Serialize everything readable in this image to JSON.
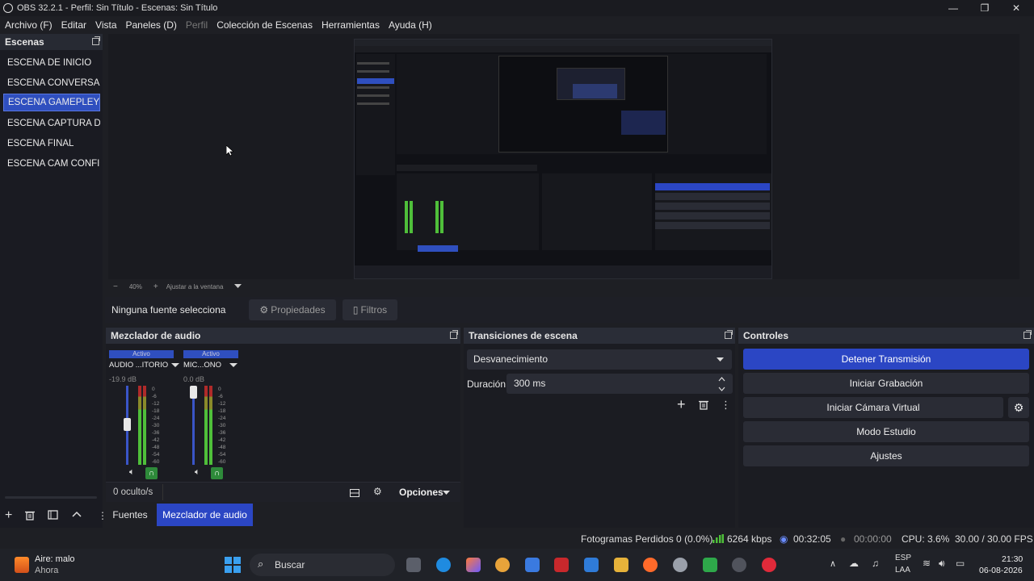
{
  "window": {
    "title": "OBS 32.2.1 - Perfil: Sin Título - Escenas: Sin Título",
    "minimize": "—",
    "maximize": "❐",
    "close": "✕"
  },
  "menu": [
    "Archivo (F)",
    "Editar",
    "Vista",
    "Paneles (D)",
    "Perfil",
    "Colección de Escenas",
    "Herramientas",
    "Ayuda (H)"
  ],
  "scenes": {
    "title": "Escenas",
    "items": [
      {
        "label": "ESCENA DE INICIO",
        "selected": false
      },
      {
        "label": "ESCENA CONVERSANDO",
        "selected": false
      },
      {
        "label": "ESCENA GAMEPLEY",
        "selected": true
      },
      {
        "label": "ESCENA CAPTURA DE P",
        "selected": false
      },
      {
        "label": "ESCENA FINAL",
        "selected": false
      },
      {
        "label": "ESCENA CAM CONFIGU",
        "selected": false
      }
    ]
  },
  "zoom": {
    "minus": "−",
    "value": "40%",
    "plus": "+",
    "fit": "Ajustar a la ventana"
  },
  "sources_bar": {
    "label": "Ninguna fuente selecciona",
    "properties": "Propiedades",
    "filters": "Filtros"
  },
  "audio_mixer": {
    "title": "Mezclador de audio",
    "channels": [
      {
        "tag": "Activo",
        "name": "AUDIO ...ITORIO",
        "db": "-19.9 dB",
        "volume": 0.55
      },
      {
        "tag": "Activo",
        "name": "MIC...ONO",
        "db": "0.0 dB",
        "volume": 1.0
      }
    ],
    "scale": [
      "0",
      "-6",
      "-12",
      "-18",
      "-24",
      "-30",
      "-36",
      "-42",
      "-48",
      "-54",
      "-60"
    ],
    "hidden": "0 oculto/s",
    "options": "Opciones"
  },
  "transitions": {
    "title": "Transiciones de escena",
    "selected": "Desvanecimiento",
    "duration_label": "Duración",
    "duration_value": "300 ms"
  },
  "controls": {
    "title": "Controles",
    "buttons": [
      "Detener Transmisión",
      "Iniciar Grabación",
      "Iniciar Cámara Virtual",
      "Modo Estudio",
      "Ajustes"
    ]
  },
  "bottom_tabs": [
    "Fuentes",
    "Mezclador de audio"
  ],
  "status": {
    "dropped": "Fotogramas Perdidos 0 (0.0%)",
    "bitrate": "6264 kbps",
    "stream_time": "00:32:05",
    "rec_time": "00:00:00",
    "cpu": "CPU: 3.6%",
    "fps": "30.00 / 30.00 FPS"
  },
  "taskbar": {
    "weather_line1": "Aire: malo",
    "weather_line2": "Ahora",
    "search": "Buscar",
    "lang1": "ESP",
    "lang2": "LAA",
    "time": "21:30",
    "date": "06-08-2026"
  },
  "colors": {
    "accent": "#2b46c4",
    "panel": "#1b1c22",
    "header": "#2a2d37",
    "meter_green": "#4fbf3a",
    "meter_red": "#b02a2a"
  }
}
